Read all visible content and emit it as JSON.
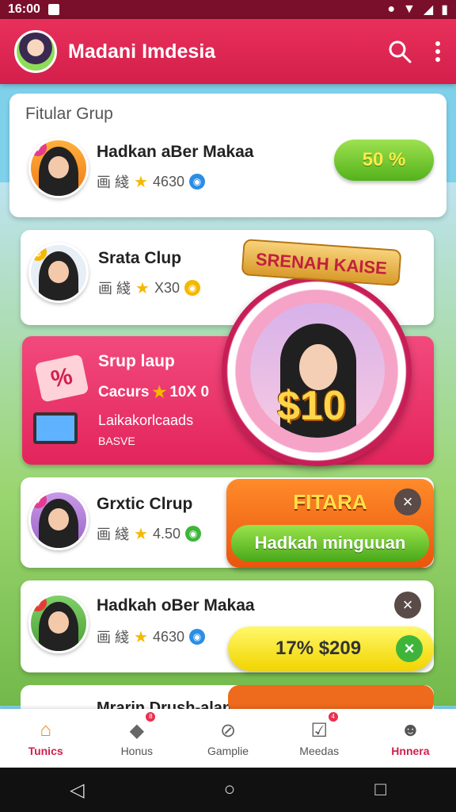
{
  "status_bar": {
    "time": "16:00"
  },
  "app_bar": {
    "title": "Madani Imdesia",
    "search_icon": "search-icon",
    "menu_icon": "more-vert-icon"
  },
  "section": {
    "title": "Fitular Grup"
  },
  "featured": {
    "name": "Hadkan aBer Makaa",
    "meta_chars": "画 綫",
    "rating": "4630",
    "button": "50 %"
  },
  "rows": [
    {
      "name": "Srata Clup",
      "meta_chars": "画 綫",
      "rating": "X30"
    },
    {
      "name": "Grxtic Clrup",
      "meta_chars": "画 綫",
      "rating": "4.50"
    },
    {
      "name": "Hadkah oBer Makaa",
      "meta_chars": "画 綫",
      "rating": "4630"
    },
    {
      "name": "Mrarin Drush-alan"
    }
  ],
  "promo": {
    "title": "Srup laup",
    "subtitle_a": "Cacurs",
    "subtitle_b": "10X 0",
    "line": "Laikakorlcaads",
    "small": "BASVE",
    "percent": "%"
  },
  "medal": {
    "banner": "SRENAH KAISE",
    "amount": "$10"
  },
  "action_orange": {
    "label": "FITARA",
    "sub": "Hadkah minguuan",
    "close": "×"
  },
  "yellow_pill": {
    "label": "17% $209",
    "close": "×"
  },
  "close_x": "×",
  "tabs": [
    {
      "label": "Tunics",
      "icon": "house-icon",
      "active": true
    },
    {
      "label": "Honus",
      "icon": "tag-icon",
      "badge": "8"
    },
    {
      "label": "Gamplie",
      "icon": "compass-icon"
    },
    {
      "label": "Meedas",
      "icon": "checkbox-icon",
      "badge": "4"
    },
    {
      "label": "Hnnera",
      "icon": "person-icon",
      "active": true
    }
  ],
  "colors": {
    "brand": "#d41f4c",
    "accent_green": "#53b21c",
    "accent_orange": "#e9550d",
    "accent_yellow": "#f2d400"
  }
}
